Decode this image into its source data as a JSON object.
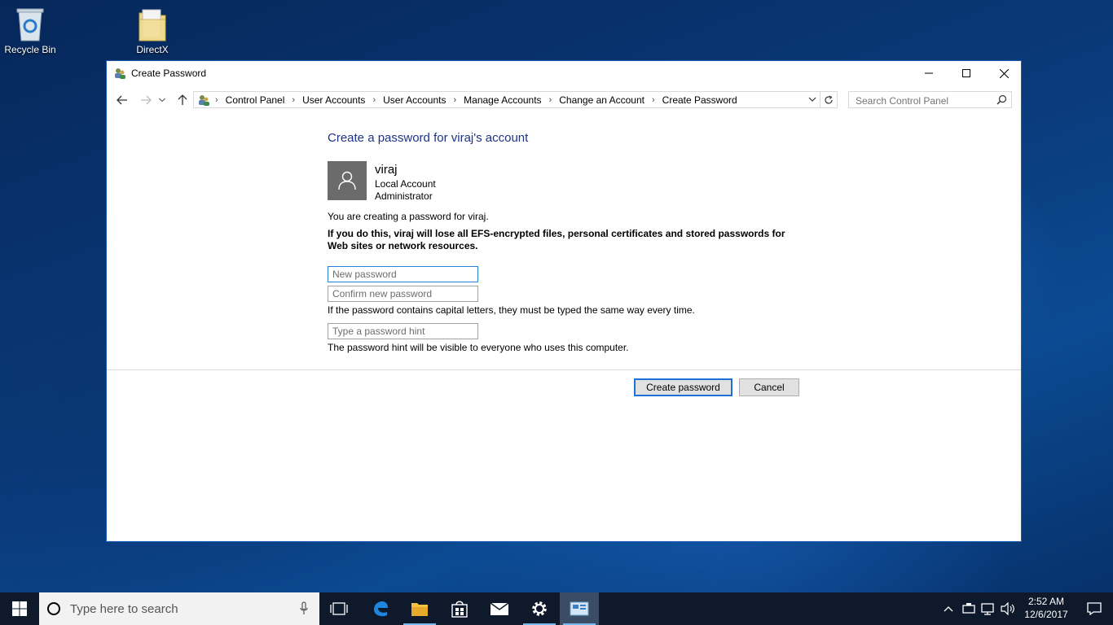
{
  "desktop": {
    "icons": [
      {
        "label": "Recycle Bin"
      },
      {
        "label": "DirectX"
      }
    ]
  },
  "window": {
    "title": "Create Password",
    "breadcrumbs": [
      "Control Panel",
      "User Accounts",
      "User Accounts",
      "Manage Accounts",
      "Change an Account",
      "Create Password"
    ],
    "search_placeholder": "Search Control Panel"
  },
  "content": {
    "heading": "Create a password for viraj's account",
    "user": {
      "name": "viraj",
      "type": "Local Account",
      "role": "Administrator"
    },
    "info": "You are creating a password for viraj.",
    "warning": "If you do this, viraj will lose all EFS-encrypted files, personal certificates and stored passwords for Web sites or network resources.",
    "fields": {
      "new_password_placeholder": "New password",
      "confirm_password_placeholder": "Confirm new password",
      "hint_placeholder": "Type a password hint"
    },
    "note_capitals": "If the password contains capital letters, they must be typed the same way every time.",
    "note_hint": "The password hint will be visible to everyone who uses this computer.",
    "buttons": {
      "create": "Create password",
      "cancel": "Cancel"
    }
  },
  "taskbar": {
    "search_placeholder": "Type here to search",
    "time": "2:52 AM",
    "date": "12/6/2017",
    "accent": "#76b9ed"
  }
}
